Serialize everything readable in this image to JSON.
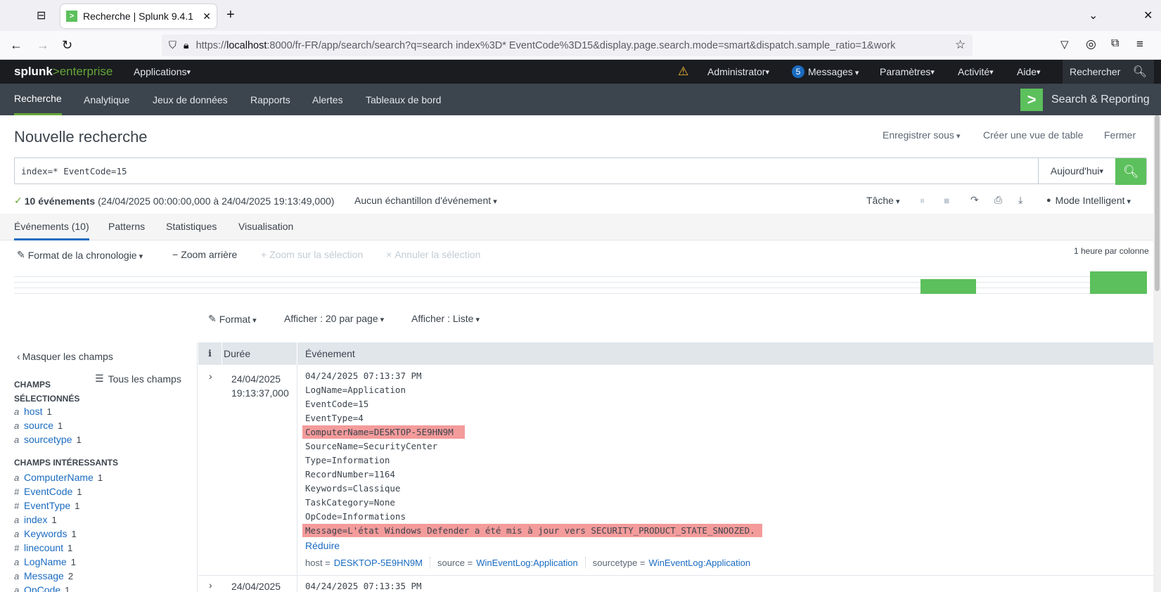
{
  "browser": {
    "tab_title": "Recherche | Splunk 9.4.1",
    "url_prefix": "https://",
    "url_host": "localhost",
    "url_rest": ":8000/fr-FR/app/search/search?q=search index%3D* EventCode%3D15&display.page.search.mode=smart&dispatch.sample_ratio=1&work"
  },
  "splunk_header": {
    "logo_left": "splunk",
    "logo_right": ">enterprise",
    "applications": "Applications",
    "user": "Administrator",
    "messages_count": "5",
    "messages": "Messages",
    "settings": "Paramètres",
    "activity": "Activité",
    "help": "Aide",
    "search_placeholder": "Rechercher"
  },
  "app_nav": {
    "items": [
      "Recherche",
      "Analytique",
      "Jeux de données",
      "Rapports",
      "Alertes",
      "Tableaux de bord"
    ],
    "app_name": "Search & Reporting"
  },
  "page": {
    "title": "Nouvelle recherche",
    "save_as": "Enregistrer sous",
    "create_table": "Créer une vue de table",
    "close": "Fermer"
  },
  "search": {
    "query": "index=* EventCode=15",
    "time_range": "Aujourd'hui"
  },
  "status": {
    "count": "10 événements",
    "range": "(24/04/2025 00:00:00,000 à 24/04/2025 19:13:49,000)",
    "sampling": "Aucun échantillon d'événement",
    "job": "Tâche",
    "mode": "Mode Intelligent"
  },
  "result_tabs": [
    "Événements (10)",
    "Patterns",
    "Statistiques",
    "Visualisation"
  ],
  "timeline": {
    "format": "Format de la chronologie",
    "zoom_out": "Zoom arrière",
    "zoom_selection": "Zoom sur la sélection",
    "cancel_selection": "Annuler la sélection",
    "scale": "1 heure par colonne"
  },
  "list_controls": {
    "format": "Format",
    "per_page": "Afficher : 20 par page",
    "display": "Afficher : Liste"
  },
  "sidebar": {
    "hide_fields": "Masquer les champs",
    "all_fields": "Tous les champs",
    "selected_title_1": "CHAMPS",
    "selected_title_2": "SÉLECTIONNÉS",
    "selected": [
      {
        "type": "a",
        "name": "host",
        "count": "1"
      },
      {
        "type": "a",
        "name": "source",
        "count": "1"
      },
      {
        "type": "a",
        "name": "sourcetype",
        "count": "1"
      }
    ],
    "interesting_title": "CHAMPS INTÉRESSANTS",
    "interesting": [
      {
        "type": "a",
        "name": "ComputerName",
        "count": "1"
      },
      {
        "type": "#",
        "name": "EventCode",
        "count": "1"
      },
      {
        "type": "#",
        "name": "EventType",
        "count": "1"
      },
      {
        "type": "a",
        "name": "index",
        "count": "1"
      },
      {
        "type": "a",
        "name": "Keywords",
        "count": "1"
      },
      {
        "type": "#",
        "name": "linecount",
        "count": "1"
      },
      {
        "type": "a",
        "name": "LogName",
        "count": "1"
      },
      {
        "type": "a",
        "name": "Message",
        "count": "2"
      },
      {
        "type": "a",
        "name": "OpCode",
        "count": "1"
      }
    ]
  },
  "table": {
    "col_i": "i",
    "col_time": "Durée",
    "col_event": "Événement",
    "event1": {
      "date": "24/04/2025",
      "time": "19:13:37,000",
      "lines": [
        "04/24/2025 07:13:37 PM",
        "LogName=Application",
        "EventCode=15",
        "EventType=4",
        "ComputerName=DESKTOP-5E9HN9M",
        "SourceName=SecurityCenter",
        "Type=Information",
        "RecordNumber=1164",
        "Keywords=Classique",
        "TaskCategory=None",
        "OpCode=Informations",
        "Message=L'état Windows Defender a été mis à jour vers SECURITY_PRODUCT_STATE_SNOOZED."
      ],
      "collapse": "Réduire",
      "host_label": "host =",
      "host_value": "DESKTOP-5E9HN9M",
      "source_label": "source =",
      "source_value": "WinEventLog:Application",
      "sourcetype_label": "sourcetype =",
      "sourcetype_value": "WinEventLog:Application"
    },
    "event2": {
      "date": "24/04/2025",
      "first_line": "04/24/2025 07:13:35 PM"
    }
  },
  "colors": {
    "accent_green": "#5cc05c",
    "highlight": "#f49b9b",
    "link": "#1a6bc0"
  }
}
